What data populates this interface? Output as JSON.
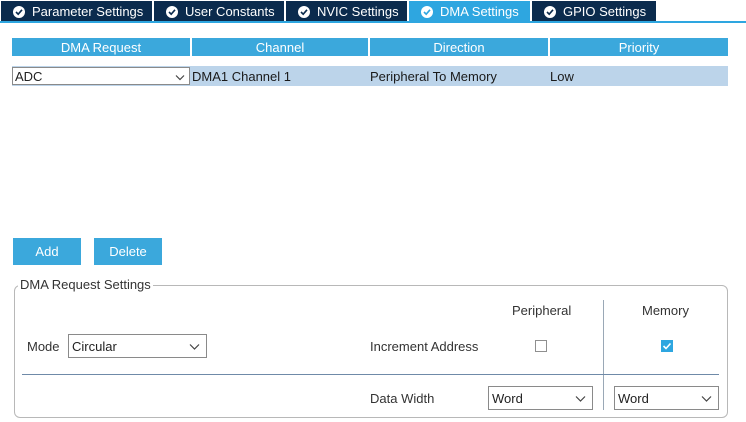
{
  "tabs": [
    {
      "label": "Parameter Settings",
      "active": false
    },
    {
      "label": "User Constants",
      "active": false
    },
    {
      "label": "NVIC Settings",
      "active": false
    },
    {
      "label": "DMA Settings",
      "active": true
    },
    {
      "label": "GPIO Settings",
      "active": false
    }
  ],
  "table": {
    "headers": [
      "DMA Request",
      "Channel",
      "Direction",
      "Priority"
    ],
    "rows": [
      {
        "request": "ADC",
        "channel": "DMA1 Channel 1",
        "direction": "Peripheral To Memory",
        "priority": "Low"
      }
    ]
  },
  "buttons": {
    "add": "Add",
    "delete": "Delete"
  },
  "settings": {
    "title": "DMA Request Settings",
    "peripheral_header": "Peripheral",
    "memory_header": "Memory",
    "mode_label": "Mode",
    "mode_value": "Circular",
    "increment_label": "Increment Address",
    "peripheral_increment": false,
    "memory_increment": true,
    "data_width_label": "Data Width",
    "peripheral_width": "Word",
    "memory_width": "Word"
  },
  "colors": {
    "accent": "#2ea6e0",
    "tab_dark": "#0b2b4d",
    "selected_row": "#bcd4ea"
  }
}
